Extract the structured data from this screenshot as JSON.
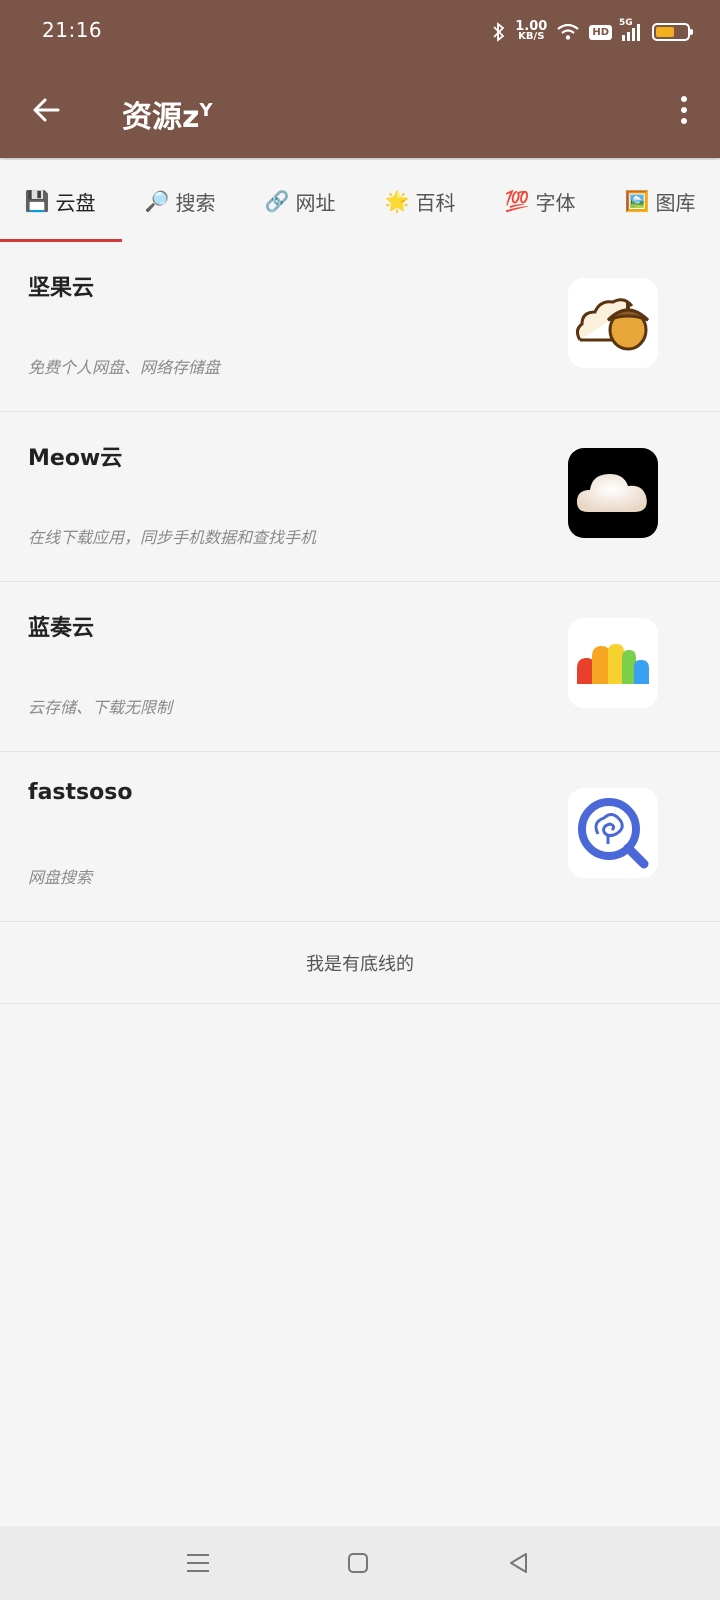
{
  "status": {
    "time": "21:16",
    "net_speed_value": "1.00",
    "net_speed_unit": "KB/S",
    "hd": "HD",
    "network": "5G",
    "battery_level": 0.6,
    "battery_color": "#f2b01e"
  },
  "appbar": {
    "title_main": "资源z",
    "title_sup": "Y",
    "color": "#7a5548"
  },
  "tabs": [
    {
      "emoji": "💾",
      "label": "云盘",
      "active": true
    },
    {
      "emoji": "🔎",
      "label": "搜索"
    },
    {
      "emoji": "🔗",
      "label": "网址"
    },
    {
      "emoji": "🌟",
      "label": "百科"
    },
    {
      "emoji": "💯",
      "label": "字体"
    },
    {
      "emoji": "🖼️",
      "label": "图库"
    }
  ],
  "items": [
    {
      "title": "坚果云",
      "desc": "免费个人网盘、网络存储盘",
      "icon": "acorn-cloud-icon"
    },
    {
      "title": "Meow云",
      "desc": "在线下载应用，同步手机数据和查找手机",
      "icon": "white-cloud-icon"
    },
    {
      "title": "蓝奏云",
      "desc": "云存储、下载无限制",
      "icon": "rainbow-cloud-icon"
    },
    {
      "title": "fastsoso",
      "desc": "网盘搜索",
      "icon": "magnifier-icon"
    }
  ],
  "footer_note": "我是有底线的",
  "accent_color": "#d23a3a"
}
